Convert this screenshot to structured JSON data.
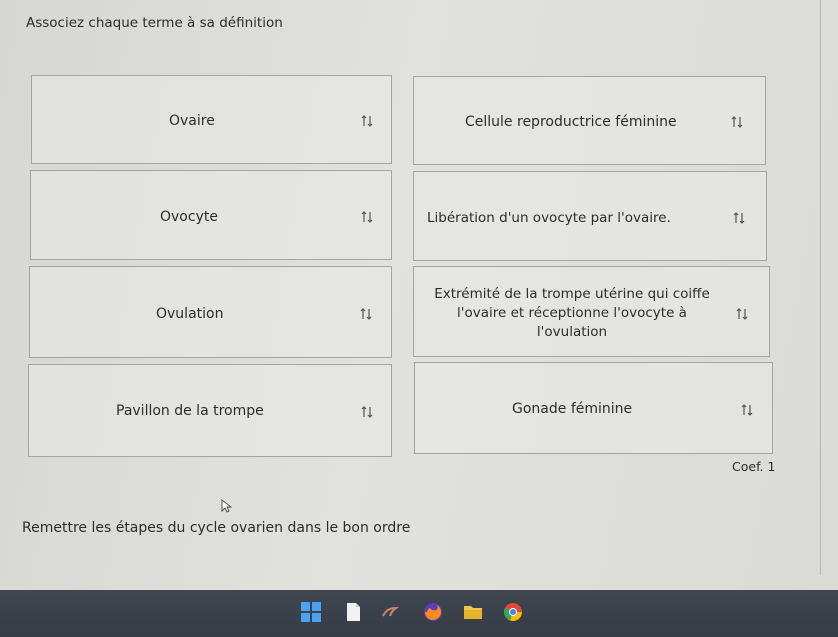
{
  "instruction": "Associez chaque terme à sa définition",
  "matching": {
    "left": [
      {
        "label": "Ovaire"
      },
      {
        "label": "Ovocyte"
      },
      {
        "label": "Ovulation"
      },
      {
        "label": "Pavillon de la trompe"
      }
    ],
    "right": [
      {
        "label": "Cellule reproductrice féminine"
      },
      {
        "label": "Libération d'un ovocyte par l'ovaire."
      },
      {
        "label": "Extrémité de la trompe utérine qui coiffe l'ovaire et réceptionne l'ovocyte à l'ovulation"
      },
      {
        "label": "Gonade féminine"
      }
    ],
    "sort_icon": "reorder-arrows-icon"
  },
  "coef": "Coef. 1",
  "next_question": "Remettre les étapes du cycle ovarien dans le bon ordre",
  "taskbar": {
    "icons": [
      "windows-start-icon",
      "file-icon",
      "app-logo-icon",
      "firefox-icon",
      "folder-icon",
      "chrome-icon"
    ]
  }
}
